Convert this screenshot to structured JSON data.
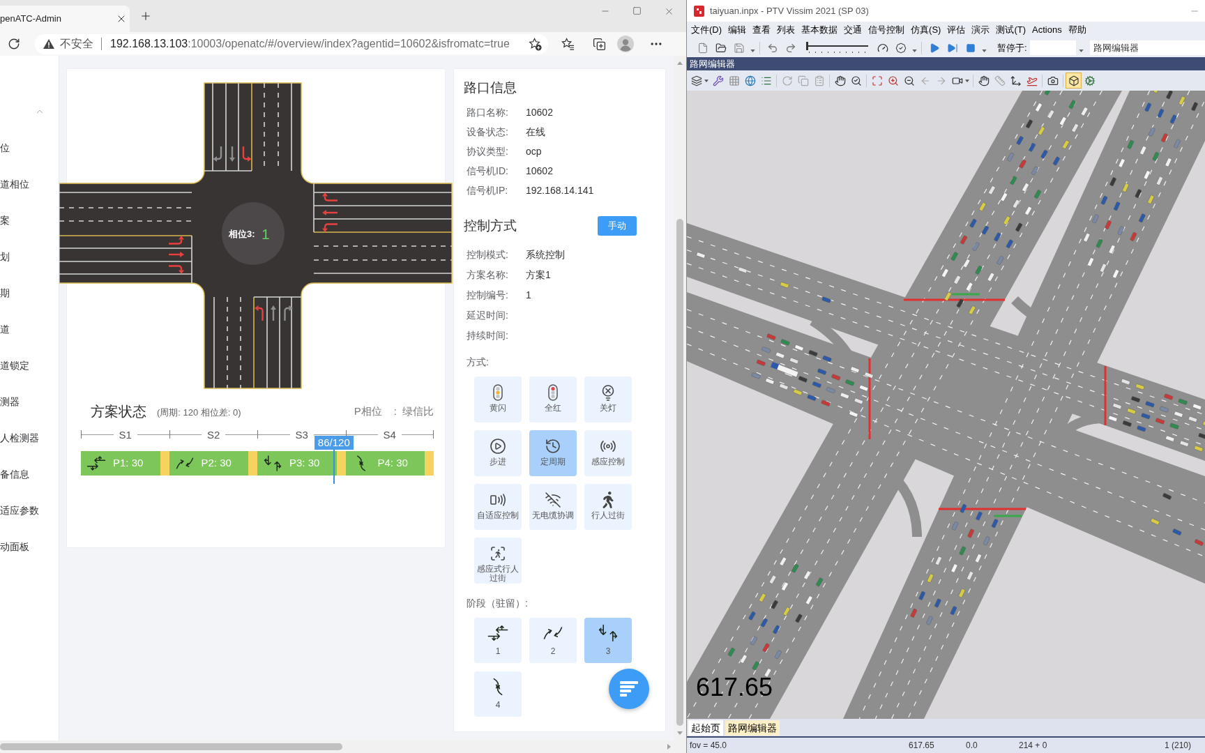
{
  "browser": {
    "tab_title": "penATC-Admin",
    "address": {
      "warning": "不安全",
      "host": "192.168.13.103",
      "path": ":10003/openatc/#/overview/index?agentid=10602&isfromatc=true"
    }
  },
  "sidebar": {
    "expanded": true,
    "items": [
      {
        "label": "位",
        "selected": false
      },
      {
        "label": "道相位",
        "selected": false
      },
      {
        "label": "案",
        "selected": false
      },
      {
        "label": "划",
        "selected": false
      },
      {
        "label": "期",
        "selected": false
      },
      {
        "label": "道",
        "selected": false
      },
      {
        "label": "道锁定",
        "selected": false
      },
      {
        "label": "测器",
        "selected": false
      },
      {
        "label": "人检测器",
        "selected": false
      },
      {
        "label": "备信息",
        "selected": false
      },
      {
        "label": "适应参数",
        "selected": false
      },
      {
        "label": "动面板",
        "selected": false
      }
    ]
  },
  "intersection": {
    "phase_label": "相位3:",
    "countdown": "1",
    "approaches": [
      {
        "kind": "north",
        "arrows": [
          {
            "kind": "left",
            "color": "#e8403c"
          },
          {
            "kind": "straight",
            "color": "#8e8e8e"
          },
          {
            "kind": "right",
            "color": "#8e8e8e"
          }
        ]
      },
      {
        "kind": "south",
        "arrows": [
          {
            "kind": "left",
            "color": "#e8403c"
          },
          {
            "kind": "straight",
            "color": "#8e8e8e"
          },
          {
            "kind": "right",
            "color": "#8e8e8e"
          }
        ]
      },
      {
        "kind": "west",
        "arrows": [
          {
            "kind": "left",
            "color": "#e8403c"
          },
          {
            "kind": "straight",
            "color": "#e8403c"
          },
          {
            "kind": "right",
            "color": "#e8403c"
          }
        ]
      },
      {
        "kind": "east",
        "arrows": [
          {
            "kind": "left",
            "color": "#e8403c"
          },
          {
            "kind": "straight",
            "color": "#e8403c"
          },
          {
            "kind": "right",
            "color": "#e8403c"
          }
        ]
      }
    ]
  },
  "plan_status": {
    "title": "方案状态",
    "summary": "(周期: 120 相位差: 0)",
    "legend": {
      "phase": "P相位",
      "separator": ":",
      "split": "绿信比"
    },
    "stages": [
      "S1",
      "S2",
      "S3",
      "S4"
    ],
    "progress": {
      "label": "86/120",
      "level": 0.717
    },
    "phases": [
      {
        "label": "P1: 30",
        "kind": "ew-through"
      },
      {
        "label": "P2: 30",
        "kind": "ew-left"
      },
      {
        "label": "P3: 30",
        "kind": "ns-through"
      },
      {
        "label": "P4: 30",
        "kind": "ns-left"
      }
    ]
  },
  "intersection_info": {
    "title": "路口信息",
    "rows": [
      {
        "label": "路口名称:",
        "value": "10602"
      },
      {
        "label": "设备状态:",
        "value": "在线"
      },
      {
        "label": "协议类型:",
        "value": "ocp"
      },
      {
        "label": "信号机ID:",
        "value": "10602"
      },
      {
        "label": "信号机IP:",
        "value": "192.168.14.141"
      }
    ]
  },
  "control": {
    "title": "控制方式",
    "action": "手动",
    "rows": [
      {
        "label": "控制模式:",
        "value": "系统控制"
      },
      {
        "label": "方案名称:",
        "value": "方案1"
      },
      {
        "label": "控制编号:",
        "value": "1"
      },
      {
        "label": "延迟时间:"
      },
      {
        "label": "持续时间:"
      }
    ],
    "modes_label": "方式:",
    "modes": [
      {
        "label": "黄闪",
        "kind": "yellow-flash",
        "selected": false
      },
      {
        "label": "全红",
        "kind": "all-red",
        "selected": false
      },
      {
        "label": "关灯",
        "kind": "lights-off",
        "selected": false
      },
      {
        "label": "步进",
        "kind": "step",
        "selected": false
      },
      {
        "label": "定周期",
        "kind": "fixed-cycle",
        "selected": true
      },
      {
        "label": "感应控制",
        "kind": "actuated",
        "selected": false
      },
      {
        "label": "自适应控制",
        "kind": "adaptive",
        "selected": false
      },
      {
        "label": "无电缆协调",
        "kind": "cableless",
        "selected": false
      },
      {
        "label": "行人过街",
        "kind": "pedestrian",
        "selected": false
      },
      {
        "label": "感应式行人过街",
        "kind": "actuated-pedestrian",
        "selected": false
      }
    ],
    "stages_label": "阶段（驻留）:",
    "stages": [
      {
        "label": "1",
        "kind": "ew-through",
        "selected": false
      },
      {
        "label": "2",
        "kind": "ew-left",
        "selected": false
      },
      {
        "label": "3",
        "kind": "ns-through",
        "selected": true
      },
      {
        "label": "4",
        "kind": "ns-left",
        "selected": false
      }
    ]
  },
  "vissim": {
    "title": "taiyuan.inpx - PTV Vissim 2021 (SP 03)",
    "menu": [
      "文件(D)",
      "编辑",
      "查看",
      "列表",
      "基本数据",
      "交通",
      "信号控制",
      "仿真(S)",
      "评估",
      "演示",
      "测试(T)",
      "Actions",
      "帮助"
    ],
    "speed_slider": {
      "level": 0
    },
    "pause_label": "暂停于:",
    "view_selector": "路网编辑器",
    "panel_title": "路网编辑器",
    "view_3d": true,
    "sim_time": "617.65",
    "tabs": [
      {
        "label": "起始页",
        "selected": false
      },
      {
        "label": "路网编辑器",
        "selected": true
      }
    ],
    "status_bar": [
      "fov = 45.0",
      "617.65",
      "0.0",
      "214 + 0",
      "1 (210)"
    ]
  }
}
